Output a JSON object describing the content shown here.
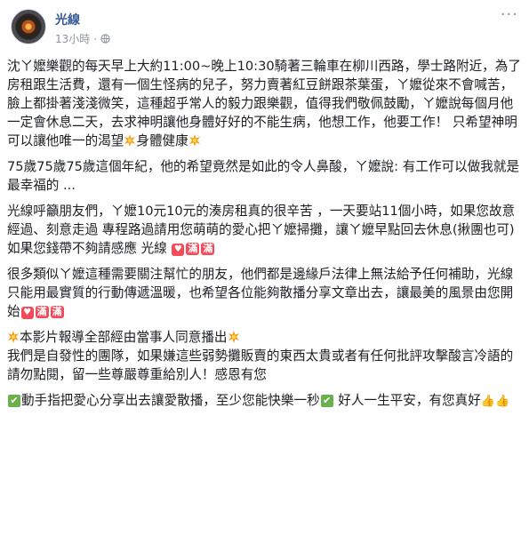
{
  "post": {
    "page_name": "光線",
    "time": "13小時",
    "dot": "·",
    "more": "···"
  },
  "paragraphs": {
    "p1_a": "沈ㄚ嬤樂觀的每天早上大約11:00~晚上10:30騎著三輪車在柳川西路，學士路附近，為了房租跟生活費，還有一個生怪病的兒子，努力賣著紅豆餅跟茶葉蛋，ㄚ嬤從來不會喊苦，臉上都掛著淺淺微笑，這種超乎常人的毅力跟樂觀，值得我們敬佩鼓勵，ㄚ嬤說每個月他一定會休息二天，去求神明讓他身體好好的不能生病，他想工作，他要工作！ 只希望神明可以讓他唯一的渴望",
    "p1_b": "身體健康",
    "p2": "75歲75歲75歲這個年紀，他的希望竟然是如此的令人鼻酸，ㄚ嬤說: 有工作可以做我就是最幸福的 ...",
    "p3_a": "光線呼籲朋友們，ㄚ嬤10元10元的湊房租真的很辛苦 ，一天要站11個小時，如果您故意經過、刻意走過 專程路過請用您萌萌的愛心把ㄚ嬤掃攤，讓ㄚ嬤早點回去休息(揪團也可)",
    "p3_b": "如果您錢帶不夠請感應 光線",
    "p4": "很多類似ㄚ嬤這種需要關注幫忙的朋友，他們都是邊緣戶法律上無法給予任何補助，光線只能用最實質的行動傳遞溫暖，也希望各位能夠散播分享文章出去，讓最美的風景由您開始",
    "p5_a": "本影片報導全部經由當事人同意播出",
    "p5_b": "我們是自發性的團隊，如果嫌這些弱勢攤販賣的東西太貴或者有任何批評攻擊酸言冷語的請勿點閱，留一些尊嚴尊重給別人！感恩有您",
    "p6_a": "動手指把愛心分享出去讓愛散播，至少您能快樂一秒",
    "p6_b": " 好人一生平安，有您真好",
    "badge_text": "滿"
  },
  "icons": [
    "globe-icon",
    "more-icon",
    "burst-emoji",
    "heart-emoji",
    "full-badge",
    "check-emoji",
    "clap-emoji"
  ],
  "colors": {
    "link": "#365899",
    "meta": "#90949c",
    "badge": "#f34b5a",
    "check": "#6ab04c",
    "burst": "#f0a020"
  }
}
